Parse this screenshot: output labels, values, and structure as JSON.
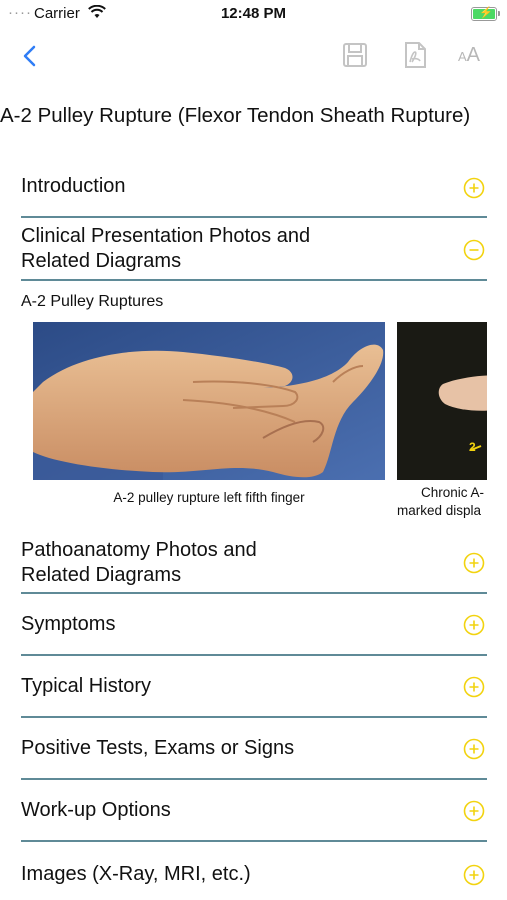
{
  "status_bar": {
    "carrier": "Carrier",
    "time": "12:48 PM"
  },
  "nav": {
    "text_size_label_small": "A",
    "text_size_label_large": "A"
  },
  "title": "A-2 Pulley Rupture (Flexor Tendon Sheath Rupture)",
  "sections": [
    {
      "label_line1": "Introduction",
      "expanded": false
    },
    {
      "label_line1": "Clinical Presentation Photos and",
      "label_line2": "Related Diagrams",
      "expanded": true
    },
    {
      "label_line1": "Pathoanatomy Photos and",
      "label_line2": "Related Diagrams",
      "expanded": false
    },
    {
      "label_line1": "Symptoms",
      "expanded": false
    },
    {
      "label_line1": "Typical History",
      "expanded": false
    },
    {
      "label_line1": "Positive Tests, Exams or Signs",
      "expanded": false
    },
    {
      "label_line1": "Work-up Options",
      "expanded": false
    },
    {
      "label_line1": "Images (X-Ray, MRI, etc.)",
      "expanded": false
    }
  ],
  "expanded_content": {
    "heading": "A-2 Pulley Ruptures",
    "photos": [
      {
        "caption": "A-2 pulley rupture left fifth finger"
      },
      {
        "caption_line1": "Chronic A-",
        "caption_line2": "marked displa",
        "marker_label": "2"
      }
    ]
  },
  "colors": {
    "accent_blue": "#2f7df6",
    "toggle_yellow": "#f2d30f",
    "divider_teal": "#5f8a97"
  }
}
